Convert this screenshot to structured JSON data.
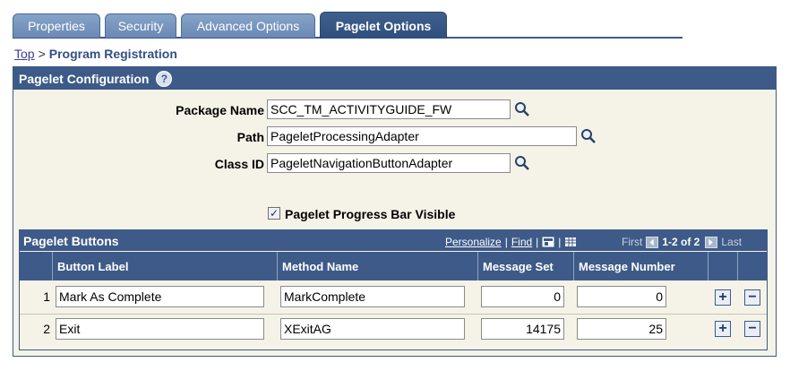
{
  "tabs": [
    {
      "label": "Properties",
      "active": false
    },
    {
      "label": "Security",
      "active": false
    },
    {
      "label": "Advanced Options",
      "active": false
    },
    {
      "label": "Pagelet Options",
      "active": true
    }
  ],
  "breadcrumb": {
    "top": "Top",
    "separator": ">",
    "current": "Program Registration"
  },
  "panel": {
    "title": "Pagelet Configuration",
    "help_icon": "question-mark",
    "help_glyph": "?"
  },
  "form": {
    "package_name": {
      "label": "Package Name",
      "value": "SCC_TM_ACTIVITYGUIDE_FW"
    },
    "path": {
      "label": "Path",
      "value": "PageletProcessingAdapter"
    },
    "class_id": {
      "label": "Class ID",
      "value": "PageletNavigationButtonAdapter"
    },
    "lookup_icon": "magnifier",
    "progress_bar": {
      "label": "Pagelet Progress Bar Visible",
      "checked": true,
      "glyph": "✓"
    }
  },
  "grid": {
    "title": "Pagelet Buttons",
    "personalize": "Personalize",
    "find": "Find",
    "separator": "|",
    "nav": {
      "first": "First",
      "count": "1-2 of 2",
      "last": "Last"
    },
    "columns": [
      "Button Label",
      "Method Name",
      "Message Set",
      "Message Number"
    ],
    "rows": [
      {
        "num": "1",
        "button_label": "Mark As Complete",
        "method_name": "MarkComplete",
        "message_set": "0",
        "message_number": "0"
      },
      {
        "num": "2",
        "button_label": "Exit",
        "method_name": "XExitAG",
        "message_set": "14175",
        "message_number": "25"
      }
    ],
    "add_glyph": "+",
    "delete_glyph": "−"
  },
  "colors": {
    "header": "#3d5a88",
    "panel_bg": "#f5f3e8",
    "tab_inactive": "#7593bd",
    "link": "#3a3a9a"
  }
}
